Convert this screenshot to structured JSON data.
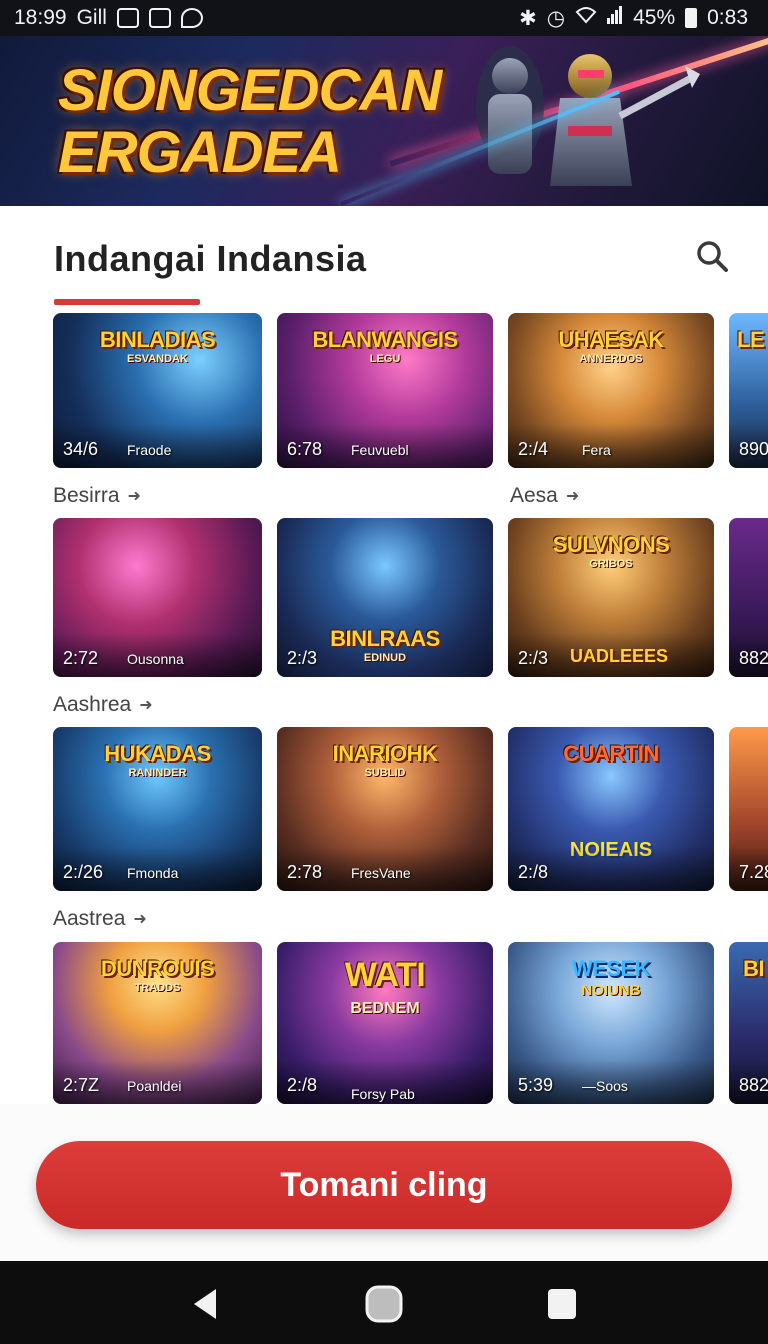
{
  "status_bar": {
    "time_left": "18:99",
    "signal_text": "Gill",
    "battery_percent": "45%",
    "clock_right": "0:83",
    "icons": [
      "message-icon",
      "image-icon",
      "shield-icon",
      "bluetooth-icon",
      "alarm-icon",
      "wifi-icon",
      "signal-icon",
      "battery-icon"
    ]
  },
  "banner": {
    "title_line1": "SIONGEDCAN",
    "title_line2": "ERGADEA"
  },
  "section": {
    "title": "Indangai Indansia",
    "accent_color": "#d63a35"
  },
  "rows": [
    {
      "label": "",
      "cards": [
        {
          "title": "BINLADIAS",
          "subtitle": "ESVANDAK",
          "duration": "34/6",
          "caption": "Fraode"
        },
        {
          "title": "BLANWANGIS",
          "subtitle": "LEGU",
          "duration": "6:78",
          "caption": "Feuvuebl"
        },
        {
          "title": "UHAESAK",
          "subtitle": "ANNERDOS",
          "duration": "2:/4",
          "caption": "Fera"
        },
        {
          "title": "LE",
          "subtitle": "",
          "duration": "890",
          "caption": ""
        }
      ]
    },
    {
      "label": "Besirra",
      "label_right": "Aesa",
      "cards": [
        {
          "title": "",
          "subtitle": "",
          "duration": "2:72",
          "caption": "Ousonna"
        },
        {
          "title": "BINLRAAS",
          "subtitle": "EDINUD",
          "duration": "2:/3",
          "caption": ""
        },
        {
          "title": "SULVNONS",
          "subtitle": "GRIBOS",
          "duration": "2:/3",
          "caption": "UADLEEES"
        },
        {
          "title": "",
          "subtitle": "",
          "duration": "882",
          "caption": ""
        }
      ]
    },
    {
      "label": "Aashrea",
      "cards": [
        {
          "title": "HUKADAS",
          "subtitle": "RANINDER",
          "duration": "2:/26",
          "caption": "Fmonda"
        },
        {
          "title": "INARIOHK",
          "subtitle": "SUBLID",
          "duration": "2:78",
          "caption": "FresVane"
        },
        {
          "title": "CUARTIN",
          "subtitle": "NOIEAIS",
          "duration": "2:/8",
          "caption": ""
        },
        {
          "title": "",
          "subtitle": "",
          "duration": "7.28",
          "caption": ""
        }
      ]
    },
    {
      "label": "Aastrea",
      "cards": [
        {
          "title": "DUNROUIS",
          "subtitle": "TRADDS",
          "duration": "2:7Z",
          "caption": "Poanldei"
        },
        {
          "title": "WATI",
          "subtitle": "BEDNEM",
          "duration": "2:/8",
          "caption": "Forsy Pab"
        },
        {
          "title": "WESEK",
          "subtitle": "NOIUNB",
          "duration": "5:39",
          "caption": "—Soos"
        },
        {
          "title": "BI",
          "subtitle": "",
          "duration": "882",
          "caption": ""
        }
      ]
    }
  ],
  "cta": {
    "label": "Tomani cling",
    "color": "#d63a35"
  },
  "nav": {
    "icons": [
      "back-icon",
      "home-icon",
      "recents-icon"
    ]
  }
}
